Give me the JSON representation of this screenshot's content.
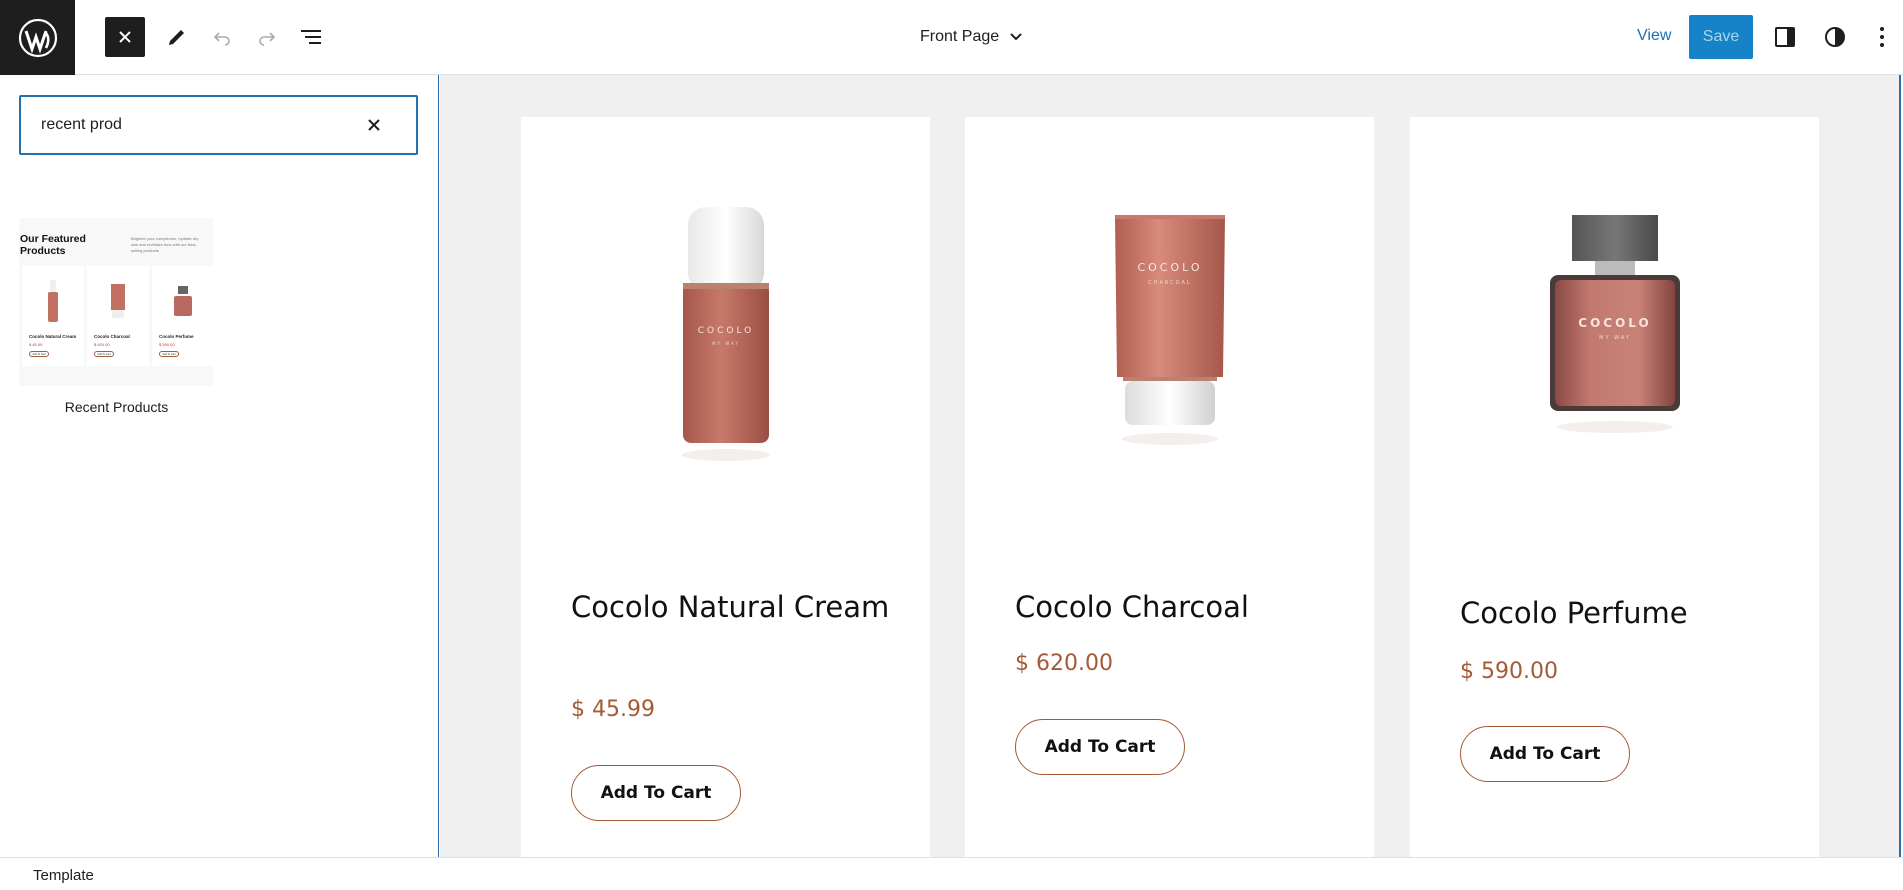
{
  "header": {
    "document_title": "Front Page",
    "view_label": "View",
    "save_label": "Save"
  },
  "inserter": {
    "search_value": "recent prod",
    "pattern": {
      "label": "Recent Products",
      "preview_title": "Our Featured Products",
      "preview_description": "Brighten your complexion, hydrate dry skin and revitalize tone with our best-selling products",
      "preview_items": [
        {
          "name": "Cocolo Natural Cream",
          "price": "$ 45.99",
          "button": "Add To Cart"
        },
        {
          "name": "Cocolo Charcoal",
          "price": "$ 620.00",
          "button": "Add To Cart"
        },
        {
          "name": "Cocolo Perfume",
          "price": "$ 590.00",
          "button": "Add To Cart"
        }
      ]
    }
  },
  "products": [
    {
      "name": "Cocolo Natural Cream",
      "price": "$ 45.99",
      "button": "Add To Cart",
      "brand": "COCOLO",
      "subbrand": "MY WAY"
    },
    {
      "name": "Cocolo Charcoal",
      "price": "$ 620.00",
      "button": "Add To Cart",
      "brand": "COCOLO",
      "subbrand": "CHARCOAL"
    },
    {
      "name": "Cocolo Perfume",
      "price": "$ 590.00",
      "button": "Add To Cart",
      "brand": "COCOLO",
      "subbrand": "MY WAY"
    }
  ],
  "footer": {
    "breadcrumb": "Template"
  },
  "colors": {
    "accent": "#2271b1",
    "price": "#a55a36",
    "product": "#c27062"
  }
}
